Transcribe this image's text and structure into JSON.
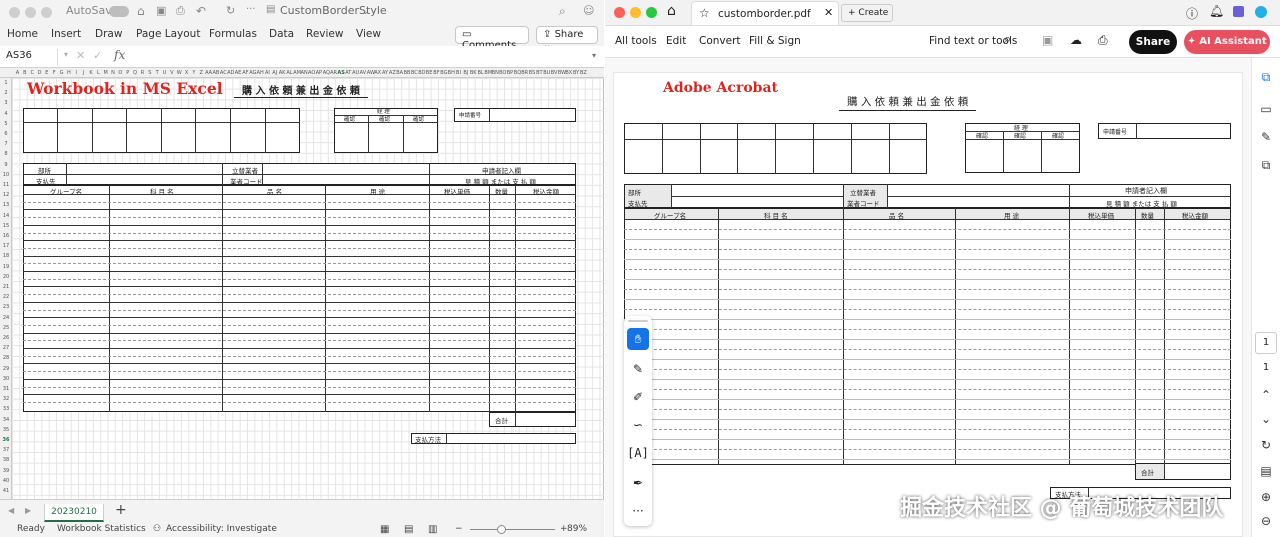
{
  "excel": {
    "autosave_label": "AutoSave",
    "file_title": "CustomBorderStyle",
    "tabs": [
      "Home",
      "Insert",
      "Draw",
      "Page Layout",
      "Formulas",
      "Data",
      "Review",
      "View"
    ],
    "comments_label": "Comments",
    "share_label": "Share",
    "name_box": "AS36",
    "fx_label": "fx",
    "sheet_heading": "Workbook in MS Excel",
    "form_title": "購 入 依 頼 兼 出 金 依 頼",
    "keiri_label": "経 理",
    "kakunin_labels": [
      "確認",
      "確認",
      "確認"
    ],
    "shinsei_bango": "申請番号",
    "busho": "部所",
    "shiharaisaki": "支払先",
    "tatekae": "立替業者",
    "gyosha_code": "業者コード",
    "kinyu_ran": "申請者記入欄",
    "mitsumori": "見 積 額 または 支 払 額",
    "columns": [
      "グループ名",
      "科 目 名",
      "品 名",
      "用 途",
      "税込単価",
      "数量",
      "税込金額"
    ],
    "total_label": "合計",
    "payment_method": "支払方法",
    "sheet_tab": "20230210",
    "add_sheet": "+",
    "status_ready": "Ready",
    "status_stats": "Workbook Statistics",
    "status_access": "Accessibility: Investigate",
    "zoom": "89%"
  },
  "acrobat": {
    "tab_title": "customborder.pdf",
    "create_label": "Create",
    "toolbar": [
      "All tools",
      "Edit",
      "Convert",
      "Fill & Sign"
    ],
    "find_label": "Find text or tools",
    "share_label": "Share",
    "ai_label": "AI Assistant",
    "heading": "Adobe Acrobat",
    "page_current": "1",
    "page_total": "1"
  },
  "watermark": "掘金技术社区 @ 葡萄城技术团队",
  "colors": {
    "excel_heading": "#e0241d",
    "acrobat_heading": "#e0241d",
    "ai_button": "#e9505f",
    "excel_green": "#1e7145"
  }
}
